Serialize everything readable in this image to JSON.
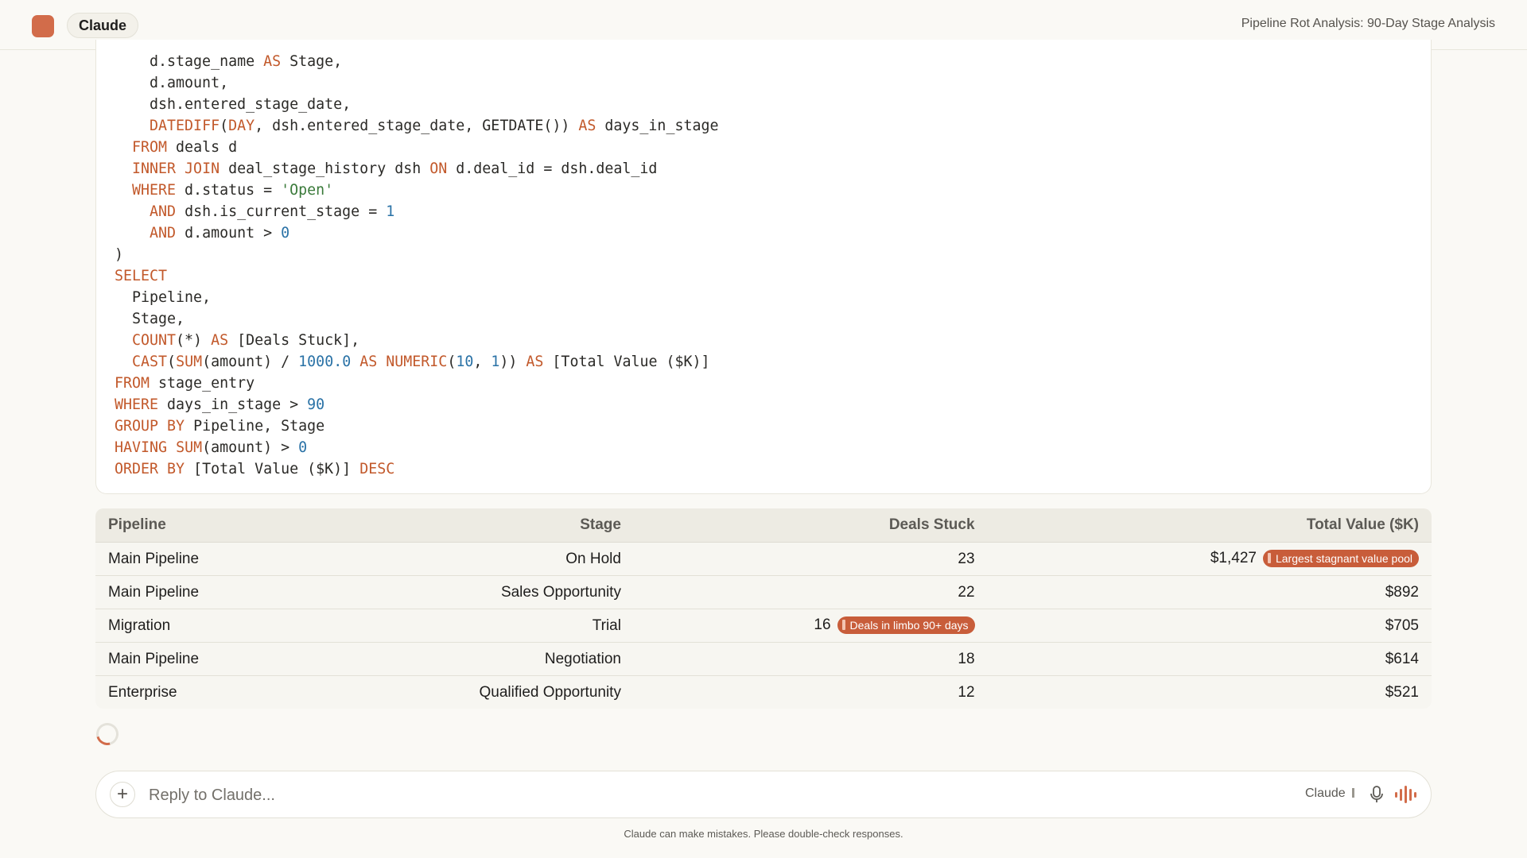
{
  "header": {
    "app_name": "Claude",
    "document_title": "Pipeline Rot Analysis: 90-Day Stage Analysis"
  },
  "code_block": {
    "language": "sql",
    "lines": [
      "    d.stage_name AS Stage,",
      "    d.amount,",
      "    dsh.entered_stage_date,",
      "    DATEDIFF(DAY, dsh.entered_stage_date, GETDATE()) AS days_in_stage",
      "  FROM deals d",
      "  INNER JOIN deal_stage_history dsh ON d.deal_id = dsh.deal_id",
      "  WHERE d.status = 'Open'",
      "    AND dsh.is_current_stage = 1",
      "    AND d.amount > 0",
      ")",
      "SELECT",
      "  Pipeline,",
      "  Stage,",
      "  COUNT(*) AS [Deals Stuck],",
      "  CAST(SUM(amount) / 1000.0 AS NUMERIC(10, 1)) AS [Total Value ($K)]",
      "FROM stage_entry",
      "WHERE days_in_stage > 90",
      "GROUP BY Pipeline, Stage",
      "HAVING SUM(amount) > 0",
      "ORDER BY [Total Value ($K)] DESC"
    ]
  },
  "results_table": {
    "columns": [
      "Pipeline",
      "Stage",
      "Deals Stuck",
      "Total Value ($K)"
    ],
    "rows": [
      {
        "pipeline": "Main Pipeline",
        "stage": "On Hold",
        "deals_stuck": "23",
        "deals_badge": "",
        "total_value": "$1,427",
        "value_badge": "Largest stagnant value pool"
      },
      {
        "pipeline": "Main Pipeline",
        "stage": "Sales Opportunity",
        "deals_stuck": "22",
        "deals_badge": "",
        "total_value": "$892",
        "value_badge": ""
      },
      {
        "pipeline": "Migration",
        "stage": "Trial",
        "deals_stuck": "16",
        "deals_badge": "Deals in limbo 90+ days",
        "total_value": "$705",
        "value_badge": ""
      },
      {
        "pipeline": "Main Pipeline",
        "stage": "Negotiation",
        "deals_stuck": "18",
        "deals_badge": "",
        "total_value": "$614",
        "value_badge": ""
      },
      {
        "pipeline": "Enterprise",
        "stage": "Qualified Opportunity",
        "deals_stuck": "12",
        "deals_badge": "",
        "total_value": "$521",
        "value_badge": ""
      }
    ],
    "badge_color": "#c85d3a"
  },
  "composer": {
    "placeholder": "Reply to Claude...",
    "model_label": "Claude",
    "add_icon": "plus-icon",
    "mic_icon": "microphone-icon",
    "voice_icon": "voice-waveform-icon"
  },
  "footer": {
    "disclaimer": "Claude can make mistakes. Please double-check responses."
  },
  "colors": {
    "accent": "#d26c4a",
    "background": "#faf9f5"
  }
}
